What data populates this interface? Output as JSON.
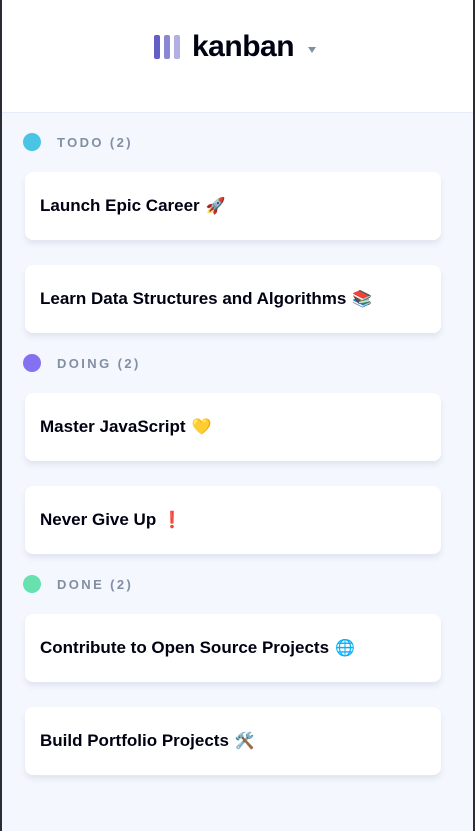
{
  "app": {
    "name": "kanban"
  },
  "colors": {
    "accent": "#635fc7",
    "todo": "#49c4e5",
    "doing": "#8471f2",
    "done": "#67e2ae"
  },
  "columns": [
    {
      "title": "TODO",
      "count": "(2)",
      "cards": [
        {
          "title": "Launch Epic Career",
          "emoji": "🚀"
        },
        {
          "title": "Learn Data Structures and Algorithms",
          "emoji": "📚"
        }
      ]
    },
    {
      "title": "DOING",
      "count": "(2)",
      "cards": [
        {
          "title": "Master JavaScript",
          "emoji": "💛"
        },
        {
          "title": "Never Give Up",
          "emoji": "❗"
        }
      ]
    },
    {
      "title": "DONE",
      "count": "(2)",
      "cards": [
        {
          "title": "Contribute to Open Source Projects",
          "emoji": "🌐"
        },
        {
          "title": "Build Portfolio Projects",
          "emoji": "🛠️"
        }
      ]
    }
  ]
}
